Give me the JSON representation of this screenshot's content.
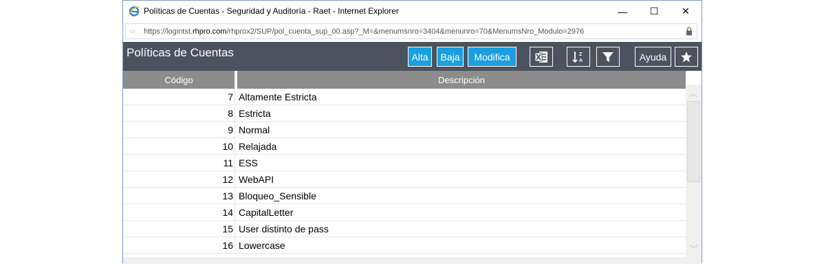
{
  "window": {
    "title": "Políticas de Cuentas - Seguridad y Auditoría - Raet - Internet Explorer",
    "url_prefix": "https://logintst.",
    "url_domain": "rhpro.com",
    "url_path": "/rhprox2/SUP/pol_cuenta_sup_00.asp?_M=&menumsnro=3404&menunro=70&MenumsNro_Modulo=2976",
    "minimize_glyph": "—",
    "maximize_glyph": "☐",
    "close_glyph": "✕"
  },
  "toolbar": {
    "title": "Políticas de Cuentas",
    "alta_label": "Alta",
    "baja_label": "Baja",
    "modifica_label": "Modifica",
    "ayuda_label": "Ayuda",
    "icons": [
      "excel-icon",
      "sort-icon",
      "filter-icon",
      "star-icon"
    ]
  },
  "table": {
    "columns": [
      "Código",
      "Descripción"
    ],
    "rows": [
      {
        "code": "7",
        "desc": "Altamente Estricta"
      },
      {
        "code": "8",
        "desc": "Estricta"
      },
      {
        "code": "9",
        "desc": "Normal"
      },
      {
        "code": "10",
        "desc": "Relajada"
      },
      {
        "code": "11",
        "desc": "ESS"
      },
      {
        "code": "12",
        "desc": "WebAPI"
      },
      {
        "code": "13",
        "desc": "Bloqueo_Sensible"
      },
      {
        "code": "14",
        "desc": "CapitalLetter"
      },
      {
        "code": "15",
        "desc": "User distinto de pass"
      },
      {
        "code": "16",
        "desc": "Lowercase"
      }
    ]
  },
  "colors": {
    "toolbar_bg": "#4c535f",
    "accent_blue": "#1b9fe0",
    "header_bg": "#8c8c8c"
  }
}
